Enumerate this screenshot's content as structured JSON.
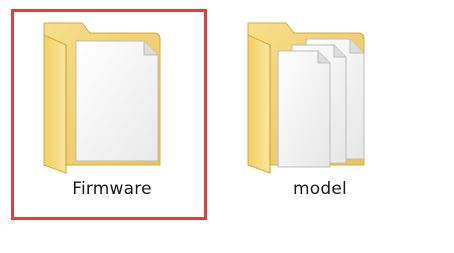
{
  "folders": [
    {
      "label": "Firmware",
      "icon": "folder-with-single-document-icon",
      "selected": true
    },
    {
      "label": "model",
      "icon": "folder-with-multiple-documents-icon",
      "selected": false
    }
  ],
  "colors": {
    "selection_border": "#e0403a",
    "folder_back": "#f3d36e",
    "folder_front": "#f7e08a",
    "paper": "#ffffff"
  }
}
